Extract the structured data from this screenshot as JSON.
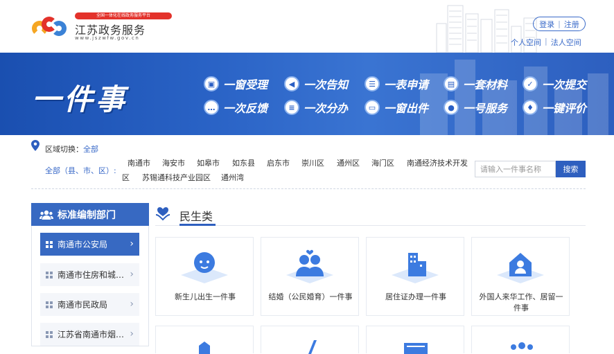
{
  "header": {
    "badge": "全国一体化在线政务服务平台",
    "title": "江苏政务服务",
    "url": "www.jszwfw.gov.cn",
    "login": "登录",
    "register": "注册",
    "personal": "个人空间",
    "legal": "法人空间"
  },
  "banner": {
    "title": "一件事",
    "features": [
      {
        "label": "一窗受理",
        "icon": "window-icon"
      },
      {
        "label": "一次告知",
        "icon": "megaphone-icon"
      },
      {
        "label": "一表申请",
        "icon": "form-icon"
      },
      {
        "label": "一套材料",
        "icon": "document-icon"
      },
      {
        "label": "一次提交",
        "icon": "check-icon"
      },
      {
        "label": "一次反馈",
        "icon": "chat-icon"
      },
      {
        "label": "一次分办",
        "icon": "list-icon"
      },
      {
        "label": "一窗出件",
        "icon": "printer-icon"
      },
      {
        "label": "一号服务",
        "icon": "user-icon"
      },
      {
        "label": "一键评价",
        "icon": "thumbs-up-icon"
      }
    ]
  },
  "region": {
    "switch_label": "区域切换：",
    "current": "全部",
    "all_label": "全部（县、市、区）:",
    "items": [
      "南通市",
      "海安市",
      "如皋市",
      "如东县",
      "启东市",
      "崇川区",
      "通州区",
      "海门区",
      "南通经济技术开发",
      "区",
      "苏锡通科技产业园区",
      "通州湾"
    ],
    "search_placeholder": "请输入一件事名称",
    "search_button": "搜索"
  },
  "sidebar": {
    "title": "标准编制部门",
    "items": [
      {
        "label": "南通市公安局",
        "active": true
      },
      {
        "label": "南通市住房和城乡建设局",
        "active": false
      },
      {
        "label": "南通市民政局",
        "active": false
      },
      {
        "label": "江苏省南通市烟草专卖局",
        "active": false
      }
    ]
  },
  "main": {
    "category": "民生类",
    "cards": [
      {
        "label": "新生儿出生一件事"
      },
      {
        "label": "结婚（公民婚育）一件事"
      },
      {
        "label": "居住证办理一件事"
      },
      {
        "label": "外国人来华工作、居留一件事"
      }
    ]
  },
  "colors": {
    "primary": "#2e5fbf",
    "banner": "#2a63c6",
    "badge": "#e3322b"
  }
}
